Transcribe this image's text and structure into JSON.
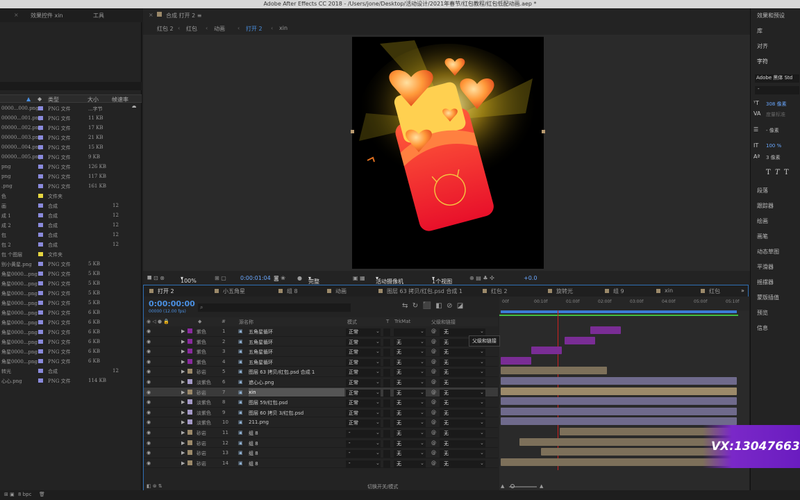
{
  "window_title": "Adobe After Effects CC 2018 - /Users/jone/Desktop/活动设计/2021年春节/红包教程/红包低配动画.aep *",
  "project_panel": {
    "tabs": [
      "效果控件 xin",
      "工具"
    ],
    "columns": [
      "类型",
      "大小",
      "帧速率"
    ],
    "rows": [
      {
        "name": "0000...000.png",
        "color": "#8a8adc",
        "type": "PNG 文件",
        "size": "...字节"
      },
      {
        "name": "00000...001.png",
        "color": "#8a8adc",
        "type": "PNG 文件",
        "size": "11 KB"
      },
      {
        "name": "00000...002.png",
        "color": "#8a8adc",
        "type": "PNG 文件",
        "size": "17 KB"
      },
      {
        "name": "00000...003.png",
        "color": "#8a8adc",
        "type": "PNG 文件",
        "size": "21 KB"
      },
      {
        "name": "00000...004.png",
        "color": "#8a8adc",
        "type": "PNG 文件",
        "size": "15 KB"
      },
      {
        "name": "00000...005.png",
        "color": "#8a8adc",
        "type": "PNG 文件",
        "size": "9 KB"
      },
      {
        "name": "png",
        "color": "#8a8adc",
        "type": "PNG 文件",
        "size": "126 KB"
      },
      {
        "name": "png",
        "color": "#8a8adc",
        "type": "PNG 文件",
        "size": "117 KB"
      },
      {
        "name": ".png",
        "color": "#8a8adc",
        "type": "PNG 文件",
        "size": "161 KB"
      },
      {
        "name": "色",
        "color": "#e6d640",
        "type": "文件夹",
        "size": ""
      },
      {
        "name": "画",
        "color": "#8a8adc",
        "type": "合成",
        "size": "",
        "fps": "12"
      },
      {
        "name": "成 1",
        "color": "#8a8adc",
        "type": "合成",
        "size": "",
        "fps": "12"
      },
      {
        "name": "成 2",
        "color": "#8a8adc",
        "type": "合成",
        "size": "",
        "fps": "12"
      },
      {
        "name": "包",
        "color": "#8a8adc",
        "type": "合成",
        "size": "",
        "fps": "12"
      },
      {
        "name": "包 2",
        "color": "#8a8adc",
        "type": "合成",
        "size": "",
        "fps": "12"
      },
      {
        "name": "包 个图层",
        "color": "#e6d640",
        "type": "文件夹",
        "size": ""
      },
      {
        "name": "别小黄星.png",
        "color": "#8a8adc",
        "type": "PNG 文件",
        "size": "5 KB"
      },
      {
        "name": "角星0000...png",
        "color": "#8a8adc",
        "type": "PNG 文件",
        "size": "5 KB"
      },
      {
        "name": "角星0000...png",
        "color": "#8a8adc",
        "type": "PNG 文件",
        "size": "5 KB"
      },
      {
        "name": "角星0000...png",
        "color": "#8a8adc",
        "type": "PNG 文件",
        "size": "5 KB"
      },
      {
        "name": "角星0000...png",
        "color": "#8a8adc",
        "type": "PNG 文件",
        "size": "5 KB"
      },
      {
        "name": "角星0000...png",
        "color": "#8a8adc",
        "type": "PNG 文件",
        "size": "6 KB"
      },
      {
        "name": "角星0000...png",
        "color": "#8a8adc",
        "type": "PNG 文件",
        "size": "6 KB"
      },
      {
        "name": "角星0000...png",
        "color": "#8a8adc",
        "type": "PNG 文件",
        "size": "6 KB"
      },
      {
        "name": "角星0000...png",
        "color": "#8a8adc",
        "type": "PNG 文件",
        "size": "6 KB"
      },
      {
        "name": "角星0000...png",
        "color": "#8a8adc",
        "type": "PNG 文件",
        "size": "6 KB"
      },
      {
        "name": "角星0000...png",
        "color": "#8a8adc",
        "type": "PNG 文件",
        "size": "6 KB"
      },
      {
        "name": "转光",
        "color": "#8a8adc",
        "type": "合成",
        "size": "",
        "fps": "12"
      },
      {
        "name": "心心.png",
        "color": "#8a8adc",
        "type": "PNG 文件",
        "size": "114 KB"
      }
    ]
  },
  "viewer": {
    "tab": "合成 打开 2",
    "breadcrumbs": [
      "红包 2",
      "红包",
      "动画",
      "打开 2",
      "xin"
    ],
    "zoom": "100%",
    "timecode": "0:00:01:04",
    "quality": "完整",
    "camera": "活动摄像机",
    "views": "1个视图",
    "exposure": "+0.0"
  },
  "timeline": {
    "tabs": [
      "打开 2",
      "小五角星",
      "组 8",
      "动画",
      "图层 63 拷贝/红包.psd 合成 1",
      "红包 2",
      "旋转光",
      "组 9",
      "xin",
      "红包"
    ],
    "timecode": "0:00:00:00",
    "fps_note": "00000 (12.00 fps)",
    "headers": [
      "#",
      "源名称",
      "模式",
      "T",
      "TrkMat",
      "父级和链接"
    ],
    "tooltip": "父级和链接",
    "ruler": [
      "00f",
      "00:10f",
      "01:00f",
      "02:00f",
      "03:00f",
      "04:00f",
      "05:00f",
      "05:10f"
    ],
    "layers": [
      {
        "num": "1",
        "label": "紫色",
        "name": "五角星循环",
        "mode": "正常",
        "trk": "",
        "parent": "无",
        "color": "#8b2aa0",
        "bar": [
          0.38,
          0.51
        ],
        "bar_color": "#7a2d95"
      },
      {
        "num": "2",
        "label": "紫色",
        "name": "五角星循环",
        "mode": "正常",
        "trk": "无",
        "parent": "无",
        "color": "#8b2aa0",
        "bar": [
          0.27,
          0.4
        ],
        "bar_color": "#7a2d95"
      },
      {
        "num": "3",
        "label": "紫色",
        "name": "五角星循环",
        "mode": "正常",
        "trk": "无",
        "parent": "无",
        "color": "#8b2aa0",
        "bar": [
          0.13,
          0.26
        ],
        "bar_color": "#7a2d95"
      },
      {
        "num": "4",
        "label": "紫色",
        "name": "五角星循环",
        "mode": "正常",
        "trk": "无",
        "parent": "无",
        "color": "#8b2aa0",
        "bar": [
          0.0,
          0.13
        ],
        "bar_color": "#7a2d95"
      },
      {
        "num": "5",
        "label": "砂岩",
        "name": "图层 63 拷贝/红包.psd 合成 1",
        "mode": "正常",
        "trk": "无",
        "parent": "无",
        "color": "#9c8a6a",
        "bar": [
          0.0,
          0.45
        ],
        "bar_color": "#7d705a"
      },
      {
        "num": "6",
        "label": "淡紫色",
        "name": "遮心心.png",
        "mode": "正常",
        "trk": "无",
        "parent": "无",
        "color": "#a59ac8",
        "bar": [
          0.0,
          1.0
        ],
        "bar_color": "#6f6a8c"
      },
      {
        "num": "7",
        "label": "砂岩",
        "name": "xin",
        "mode": "正常",
        "trk": "无",
        "parent": "无",
        "color": "#9c8a6a",
        "bar": [
          0.0,
          1.0
        ],
        "bar_color": "#9c8a6a",
        "selected": true
      },
      {
        "num": "8",
        "label": "淡紫色",
        "name": "图层 59/红包.psd",
        "mode": "正常",
        "trk": "无",
        "parent": "无",
        "color": "#a59ac8",
        "bar": [
          0.0,
          1.0
        ],
        "bar_color": "#6f6a8c"
      },
      {
        "num": "9",
        "label": "淡紫色",
        "name": "图层 60 拷贝 3/红包.psd",
        "mode": "正常",
        "trk": "无",
        "parent": "无",
        "color": "#a59ac8",
        "bar": [
          0.0,
          1.0
        ],
        "bar_color": "#6f6a8c"
      },
      {
        "num": "10",
        "label": "淡紫色",
        "name": "211.png",
        "mode": "正常",
        "trk": "无",
        "parent": "无",
        "color": "#a59ac8",
        "bar": [
          0.0,
          1.0
        ],
        "bar_color": "#6f6a8c"
      },
      {
        "num": "11",
        "label": "砂岩",
        "name": "组 8",
        "mode": "-",
        "trk": "无",
        "parent": "无",
        "color": "#9c8a6a",
        "bar": [
          0.25,
          1.0
        ],
        "bar_color": "#7d705a"
      },
      {
        "num": "12",
        "label": "砂岩",
        "name": "组 8",
        "mode": "-",
        "trk": "无",
        "parent": "无",
        "color": "#9c8a6a",
        "bar": [
          0.08,
          1.0
        ],
        "bar_color": "#7d705a"
      },
      {
        "num": "13",
        "label": "砂岩",
        "name": "组 8",
        "mode": "-",
        "trk": "无",
        "parent": "无",
        "color": "#9c8a6a",
        "bar": [
          0.17,
          1.0
        ],
        "bar_color": "#7d705a"
      },
      {
        "num": "14",
        "label": "砂岩",
        "name": "组 8",
        "mode": "-",
        "trk": "无",
        "parent": "无",
        "color": "#9c8a6a",
        "bar": [
          0.0,
          1.0
        ],
        "bar_color": "#7d705a"
      }
    ],
    "footer_toggle": "切换开关/模式"
  },
  "right_panel": {
    "items": [
      "效果和预设",
      "库",
      "对齐",
      "字符"
    ],
    "font": "Adobe 黑体 Std",
    "font_style": "-",
    "size": "308 像素",
    "tracking_label": "度量标准",
    "leading": "- 像素",
    "scale": "100 %",
    "baseline": "3 像素",
    "panels": [
      "段落",
      "跟踪器",
      "绘画",
      "画笔",
      "动态草图",
      "平滑器",
      "摇摆器",
      "蒙版插值",
      "预览",
      "信息"
    ]
  },
  "bottom": {
    "bpc": "8 bpc"
  },
  "watermark": "VX:13047663"
}
